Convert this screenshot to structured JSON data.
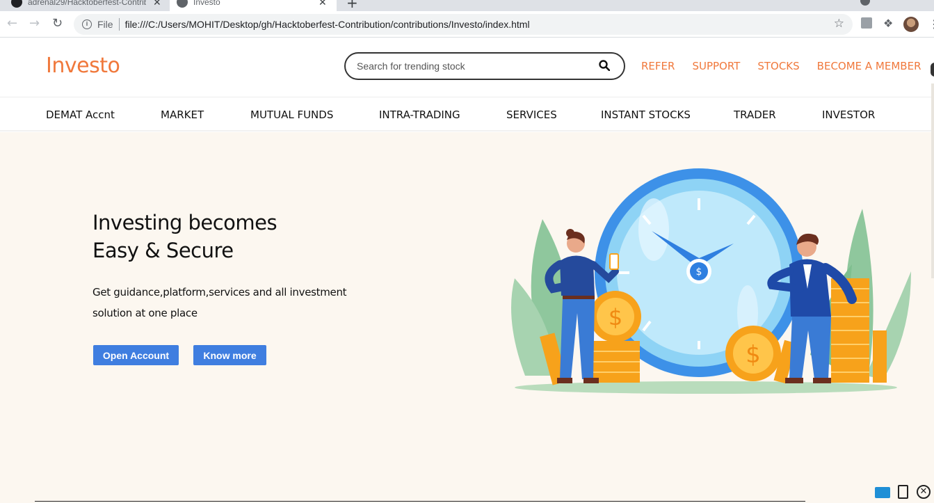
{
  "browser": {
    "tabs": [
      {
        "title": "adrenal29/Hacktoberfest-Contrib",
        "close": "✕"
      },
      {
        "title": "Investo",
        "close": "✕"
      }
    ],
    "new_tab": "+",
    "file_label": "File",
    "url": "file:///C:/Users/MOHIT/Desktop/gh/Hacktoberfest-Contribution/contributions/Investo/index.html"
  },
  "header": {
    "logo": "Investo",
    "search_placeholder": "Search for trending stock",
    "links": [
      "REFER",
      "SUPPORT",
      "STOCKS",
      "BECOME A MEMBER"
    ]
  },
  "nav": {
    "items": [
      "DEMAT Accnt",
      "MARKET",
      "MUTUAL FUNDS",
      "INTRA-TRADING",
      "SERVICES",
      "INSTANT STOCKS",
      "TRADER",
      "INVESTOR"
    ]
  },
  "hero": {
    "title_line1": "Investing becomes",
    "title_line2": "Easy & Secure",
    "description": "Get guidance,platform,services and all investment solution at one place",
    "open_account": "Open Account",
    "know_more": "Know more"
  },
  "colors": {
    "brand_orange": "#f0783b",
    "button_blue": "#3f7ee0",
    "hero_bg": "#fcf7f0"
  }
}
